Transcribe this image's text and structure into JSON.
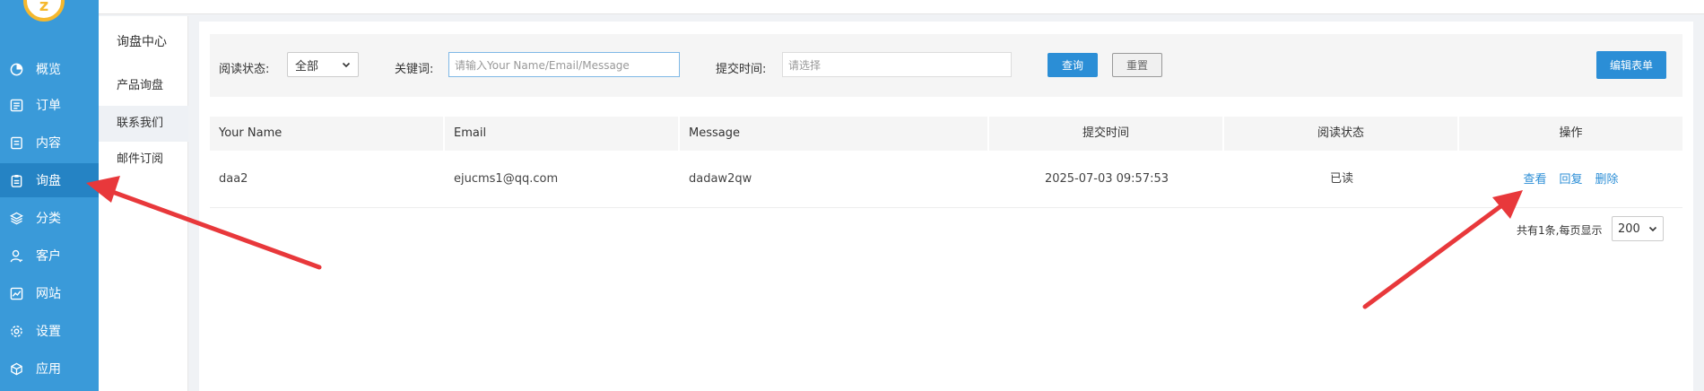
{
  "sidebar": {
    "items": [
      {
        "label": "概览",
        "icon": "pie-chart-icon"
      },
      {
        "label": "订单",
        "icon": "list-icon"
      },
      {
        "label": "内容",
        "icon": "document-icon"
      },
      {
        "label": "询盘",
        "icon": "clipboard-icon",
        "active": true
      },
      {
        "label": "分类",
        "icon": "layers-icon"
      },
      {
        "label": "客户",
        "icon": "user-icon"
      },
      {
        "label": "网站",
        "icon": "chart-icon"
      },
      {
        "label": "设置",
        "icon": "gear-icon"
      },
      {
        "label": "应用",
        "icon": "cube-icon"
      }
    ]
  },
  "submenu": {
    "title": "询盘中心",
    "items": [
      {
        "label": "产品询盘"
      },
      {
        "label": "联系我们",
        "active": true
      },
      {
        "label": "邮件订阅"
      }
    ]
  },
  "filter": {
    "read_status_label": "阅读状态:",
    "read_status_value": "全部",
    "keyword_label": "关键词:",
    "keyword_placeholder": "请输入Your Name/Email/Message",
    "submit_time_label": "提交时间:",
    "submit_time_placeholder": "请选择",
    "query_button": "查询",
    "reset_button": "重置",
    "edit_form_button": "编辑表单"
  },
  "table": {
    "headers": [
      "Your Name",
      "Email",
      "Message",
      "提交时间",
      "阅读状态",
      "操作"
    ],
    "rows": [
      {
        "name": "daa2",
        "email": "ejucms1@qq.com",
        "message": "dadaw2qw",
        "time": "2025-07-03 09:57:53",
        "status": "已读",
        "actions": [
          "查看",
          "回复",
          "删除"
        ]
      }
    ]
  },
  "pager": {
    "summary": "共有1条,每页显示",
    "page_size": "200"
  },
  "colors": {
    "sidebar": "#3a9ad9",
    "accent": "#2b8ed6",
    "annotation_arrow": "#e8383b"
  }
}
